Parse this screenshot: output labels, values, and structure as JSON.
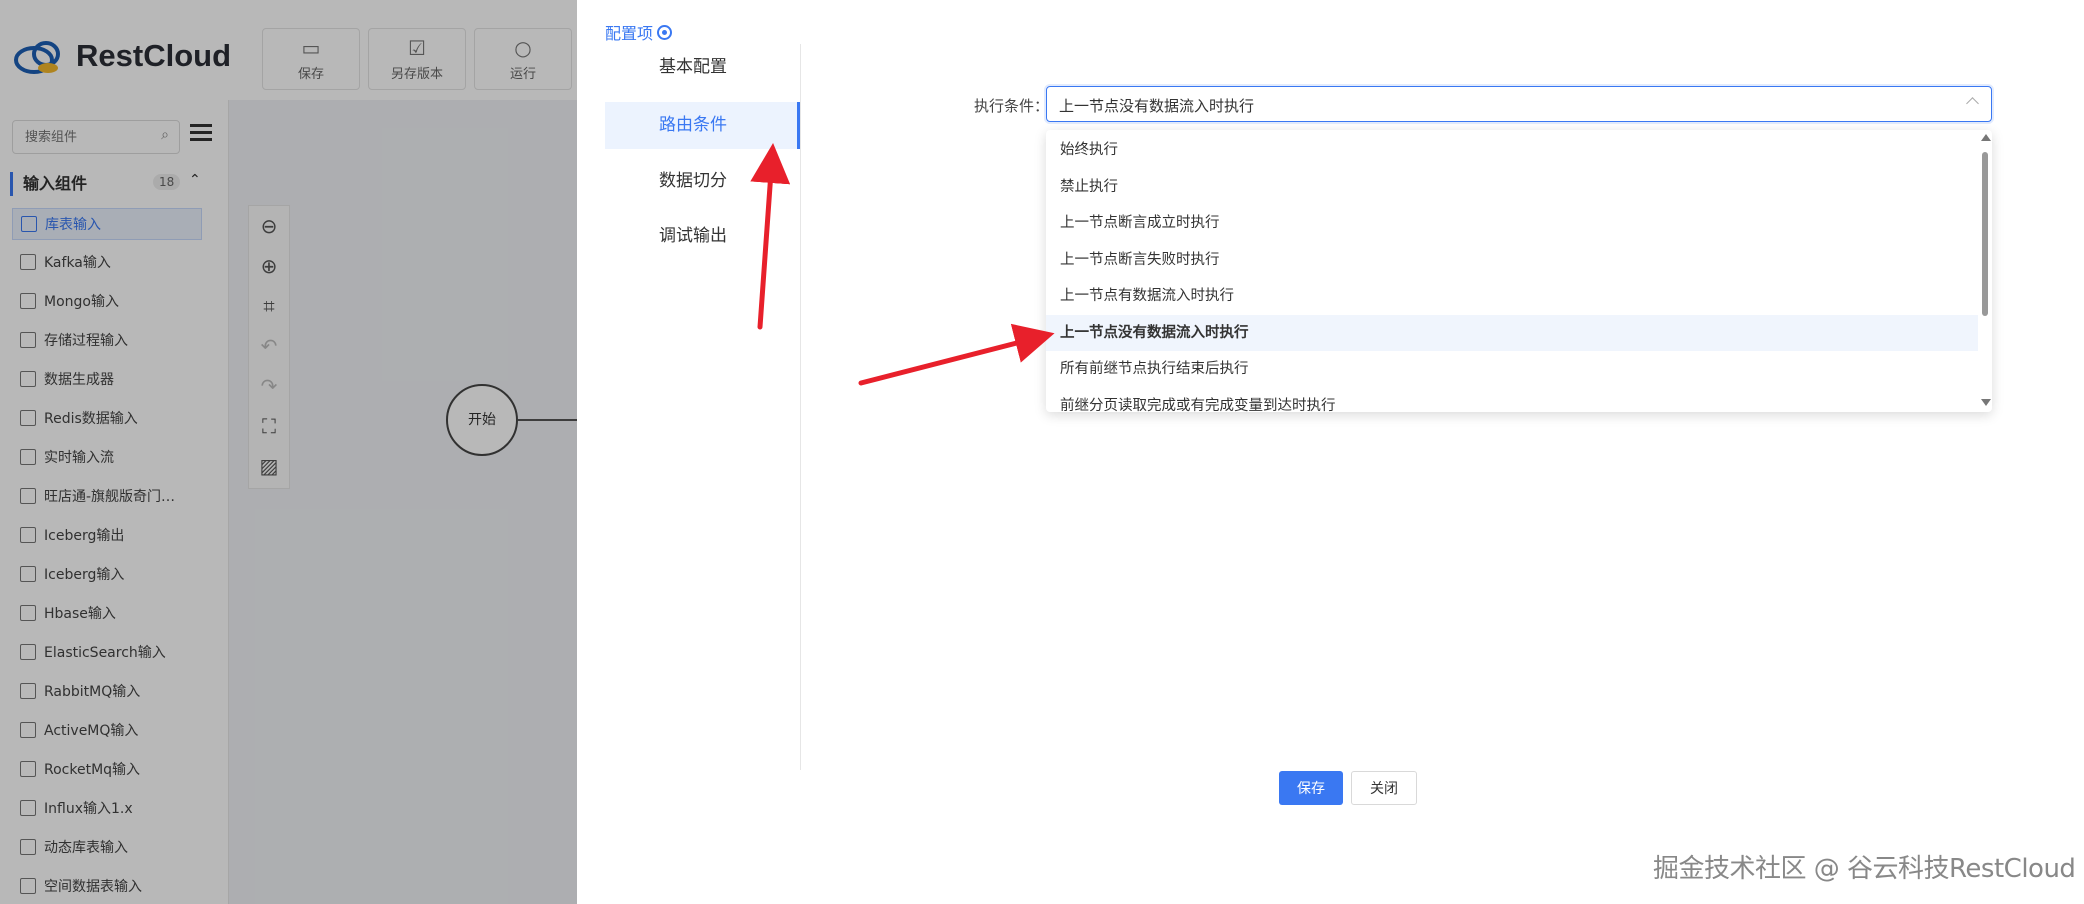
{
  "app": {
    "brand": "RestCloud",
    "toolbar": [
      {
        "label": "保存",
        "icon": "save-icon"
      },
      {
        "label": "另存版本",
        "icon": "save-version-icon"
      },
      {
        "label": "运行",
        "icon": "run-icon"
      }
    ]
  },
  "sidebar": {
    "search_placeholder": "搜索组件",
    "group": {
      "title": "输入组件",
      "count": "18"
    },
    "items": [
      {
        "label": "库表输入",
        "active": true
      },
      {
        "label": "Kafka输入"
      },
      {
        "label": "Mongo输入"
      },
      {
        "label": "存储过程输入"
      },
      {
        "label": "数据生成器"
      },
      {
        "label": "Redis数据输入"
      },
      {
        "label": "实时输入流"
      },
      {
        "label": "旺店通-旗舰版奇门…"
      },
      {
        "label": "Iceberg输出"
      },
      {
        "label": "Iceberg输入"
      },
      {
        "label": "Hbase输入"
      },
      {
        "label": "ElasticSearch输入"
      },
      {
        "label": "RabbitMQ输入"
      },
      {
        "label": "ActiveMQ输入"
      },
      {
        "label": "RocketMq输入"
      },
      {
        "label": "Influx输入1.x"
      },
      {
        "label": "动态库表输入"
      },
      {
        "label": "空间数据表输入"
      }
    ]
  },
  "canvas": {
    "start_node": "开始"
  },
  "drawer": {
    "title": "配置项",
    "nav": [
      {
        "label": "基本配置"
      },
      {
        "label": "路由条件",
        "active": true
      },
      {
        "label": "数据切分"
      },
      {
        "label": "调试输出"
      }
    ],
    "condition": {
      "label": "执行条件：",
      "value": "上一节点没有数据流入时执行",
      "options": [
        "始终执行",
        "禁止执行",
        "上一节点断言成立时执行",
        "上一节点断言失败时执行",
        "上一节点有数据流入时执行",
        "上一节点没有数据流入时执行",
        "所有前继节点执行结束后执行",
        "前继分页读取完成或有完成变量到达时执行"
      ],
      "selected_index": 5
    },
    "buttons": {
      "save": "保存",
      "close": "关闭"
    }
  },
  "watermark": "掘金技术社区 @ 谷云科技RestCloud",
  "colors": {
    "accent": "#3a78f2",
    "arrow": "#e8202b"
  }
}
